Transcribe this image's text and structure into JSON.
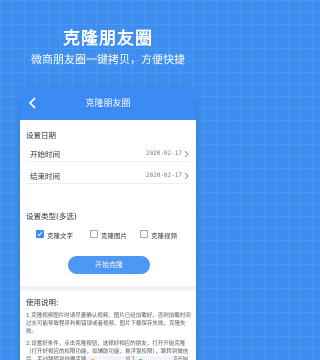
{
  "hero": {
    "title": "克隆朋友圈",
    "subtitle": "微商朋友圈一键拷贝，方便快捷"
  },
  "app": {
    "title": "克隆朋友圈",
    "back_icon": "chevron-left-icon"
  },
  "settings": {
    "date_section": "设置日期",
    "start_label": "开始时间",
    "start_value": "2020-02-17",
    "end_label": "结束时间",
    "end_value": "2020-02-17",
    "type_section": "设置类型(多选)",
    "options": [
      {
        "label": "克隆文字",
        "checked": true
      },
      {
        "label": "克隆图片",
        "checked": false
      },
      {
        "label": "克隆视频",
        "checked": false
      }
    ],
    "start_button": "开始克隆"
  },
  "usage": {
    "title": "使用说明:",
    "p1": "1.克隆视频图片时请尽量确认视频、图片已经加载好，否则加载时间过长可能导致程序判断错误或者视频、图片下载保存失败，克隆失败。",
    "p2": "2.设置好条件，点击克隆按钮，选择好相应的朋友，打开开始克隆（打开好相应的权限功能，如辅助功能，悬浮窗权限），跳转到微信后，手动跳转到你要克隆的朋友圈页面（如下图），点击悬浮窗开始克隆即可"
  },
  "colors": {
    "background": "#3d8ef0",
    "accent": "#3c8af3",
    "button": "#4f97f5"
  }
}
